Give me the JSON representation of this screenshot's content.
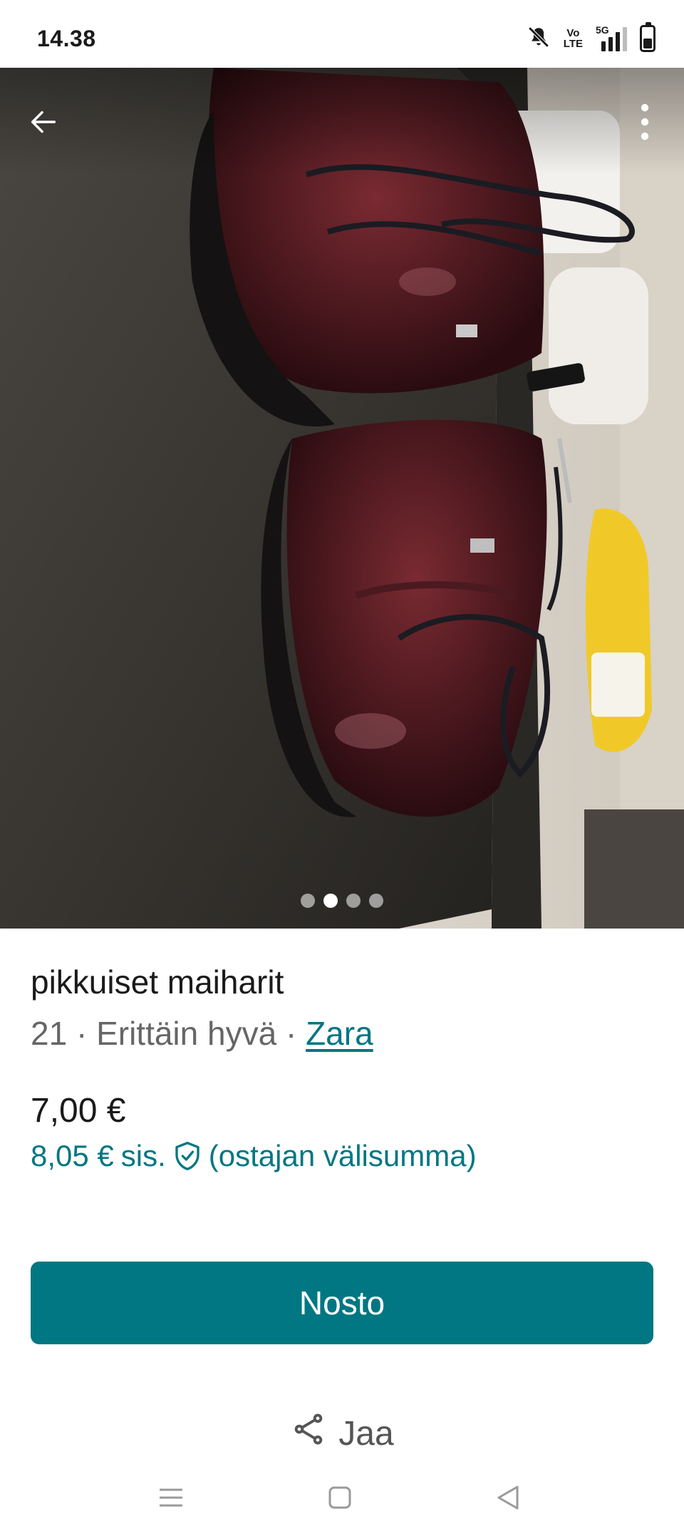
{
  "status_bar": {
    "time": "14.38",
    "volte": "Vo\nLTE",
    "network": "5G",
    "icons": [
      "mute-icon",
      "volte-icon",
      "signal-icon",
      "battery-icon"
    ]
  },
  "photo": {
    "description_icons": [
      "back-arrow-icon",
      "more-vert-icon"
    ],
    "pages": 4,
    "current_page": 2
  },
  "item": {
    "title": "pikkuiset maiharit",
    "size": "21",
    "separator": " · ",
    "condition": "Erittäin hyvä",
    "brand": "Zara",
    "price": "7,00 €",
    "buyer_price": "8,05 €",
    "buyer_incl": "sis.",
    "buyer_note": "(ostajan välisumma)"
  },
  "actions": {
    "buy_label": "Nosto",
    "share_label": "Jaa"
  },
  "colors": {
    "accent": "#007782",
    "text_primary": "#1a1a1a",
    "text_secondary": "#666666"
  }
}
